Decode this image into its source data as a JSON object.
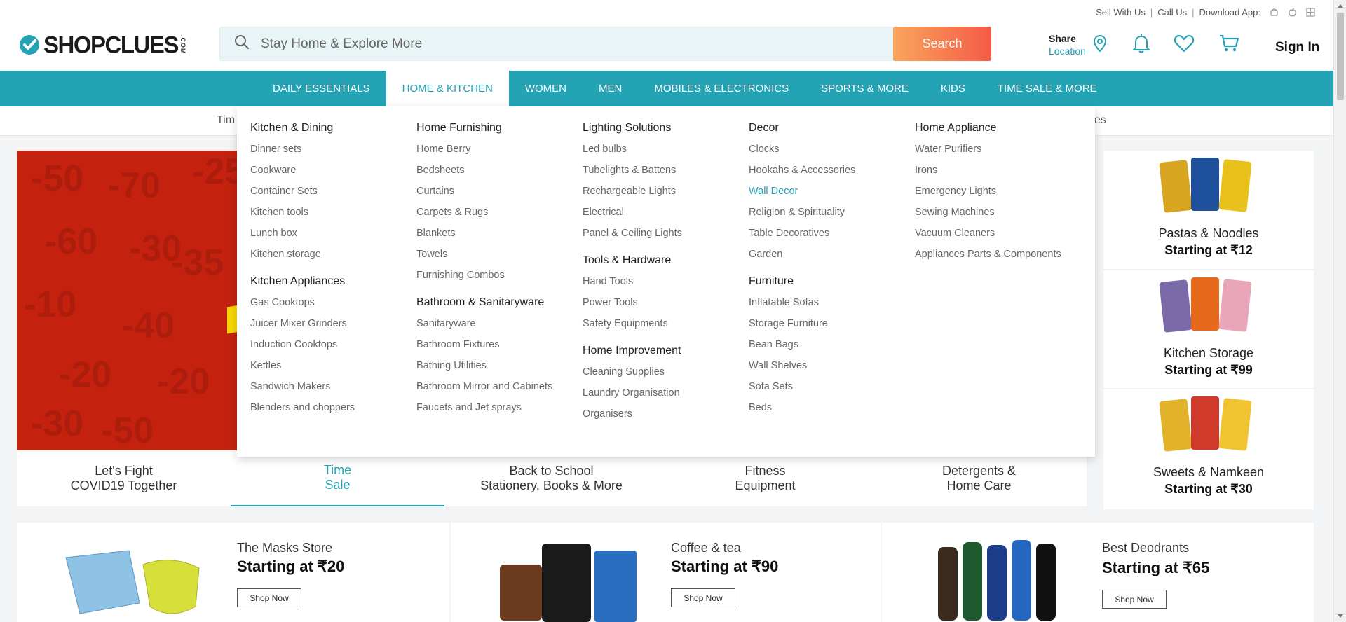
{
  "top_links": {
    "sell": "Sell With Us",
    "sep": "|",
    "call": "Call Us",
    "download": "Download App:"
  },
  "logo": {
    "text": "SHOPCLUES",
    "suffix": ".COM"
  },
  "search": {
    "placeholder": "Stay Home & Explore More",
    "button": "Search"
  },
  "header": {
    "share_label": "Share",
    "location_label": "Location",
    "signin": "Sign In"
  },
  "nav": {
    "items": [
      "DAILY ESSENTIALS",
      "HOME & KITCHEN",
      "WOMEN",
      "MEN",
      "MOBILES & ELECTRONICS",
      "SPORTS & MORE",
      "KIDS",
      "TIME SALE & MORE"
    ],
    "active": "HOME & KITCHEN"
  },
  "substrip": {
    "left": "Tim",
    "right": "ries"
  },
  "dropdown": {
    "columns": [
      {
        "groups": [
          {
            "title": "Kitchen & Dining",
            "items": [
              "Dinner sets",
              "Cookware",
              "Container Sets",
              "Kitchen tools",
              "Lunch box",
              "Kitchen storage"
            ]
          },
          {
            "title": "Kitchen Appliances",
            "items": [
              "Gas Cooktops",
              "Juicer Mixer Grinders",
              "Induction Cooktops",
              "Kettles",
              "Sandwich Makers",
              "Blenders and choppers"
            ]
          }
        ]
      },
      {
        "groups": [
          {
            "title": "Home Furnishing",
            "items": [
              "Home Berry",
              "Bedsheets",
              "Curtains",
              "Carpets & Rugs",
              "Blankets",
              "Towels",
              "Furnishing Combos"
            ]
          },
          {
            "title": "Bathroom & Sanitaryware",
            "items": [
              "Sanitaryware",
              "Bathroom Fixtures",
              "Bathing Utilities",
              "Bathroom Mirror and Cabinets",
              "Faucets and Jet sprays"
            ]
          }
        ]
      },
      {
        "groups": [
          {
            "title": "Lighting Solutions",
            "items": [
              "Led bulbs",
              "Tubelights & Battens",
              "Rechargeable Lights",
              "Electrical",
              "Panel & Ceiling Lights"
            ]
          },
          {
            "title": "Tools & Hardware",
            "items": [
              "Hand Tools",
              "Power Tools",
              "Safety Equipments"
            ]
          },
          {
            "title": "Home Improvement",
            "items": [
              "Cleaning Supplies",
              "Laundry Organisation",
              "Organisers"
            ]
          }
        ]
      },
      {
        "groups": [
          {
            "title": "Decor",
            "items": [
              "Clocks",
              "Hookahs & Accessories",
              "Wall Decor",
              "Religion & Spirituality",
              "Table Decoratives",
              "Garden"
            ]
          },
          {
            "title": "Furniture",
            "items": [
              "Inflatable Sofas",
              "Storage Furniture",
              "Bean Bags",
              "Wall Shelves",
              "Sofa Sets",
              "Beds"
            ]
          }
        ]
      },
      {
        "groups": [
          {
            "title": "Home Appliance",
            "items": [
              "Water Purifiers",
              "Irons",
              "Emergency Lights",
              "Sewing Machines",
              "Vacuum Cleaners",
              "Appliances Parts & Components"
            ]
          }
        ]
      }
    ],
    "highlighted_item": "Wall Decor"
  },
  "banner": {
    "bg_numbers": [
      "-50",
      "-70",
      "-25",
      "-60",
      "-30",
      "-10",
      "-40",
      "-20",
      "-35",
      "-50",
      "-30",
      "-20"
    ],
    "tabs": [
      {
        "line1": "Let's Fight",
        "line2": "COVID19 Together"
      },
      {
        "line1": "Time",
        "line2": "Sale"
      },
      {
        "line1": "Back to School",
        "line2": "Stationery, Books & More"
      },
      {
        "line1": "Fitness",
        "line2": "Equipment"
      },
      {
        "line1": "Detergents &",
        "line2": "Home Care"
      }
    ],
    "active_tab": 1
  },
  "right_promos": [
    {
      "title": "Pastas & Noodles",
      "sub": "Starting at ₹12"
    },
    {
      "title": "Kitchen Storage",
      "sub": "Starting at ₹99"
    },
    {
      "title": "Sweets & Namkeen",
      "sub": "Starting at ₹30"
    }
  ],
  "bottom_cards": [
    {
      "title": "The Masks Store",
      "price": "Starting at ₹20",
      "button": "Shop Now"
    },
    {
      "title": "Coffee & tea",
      "price": "Starting at ₹90",
      "button": "Shop Now"
    },
    {
      "title": "Best Deodrants",
      "price": "Starting at ₹65",
      "button": "Shop Now"
    }
  ],
  "colors": {
    "brand": "#24a3b5",
    "search_btn_start": "#f8a55c",
    "search_btn_end": "#f45b47",
    "banner_red": "#c4220f"
  }
}
